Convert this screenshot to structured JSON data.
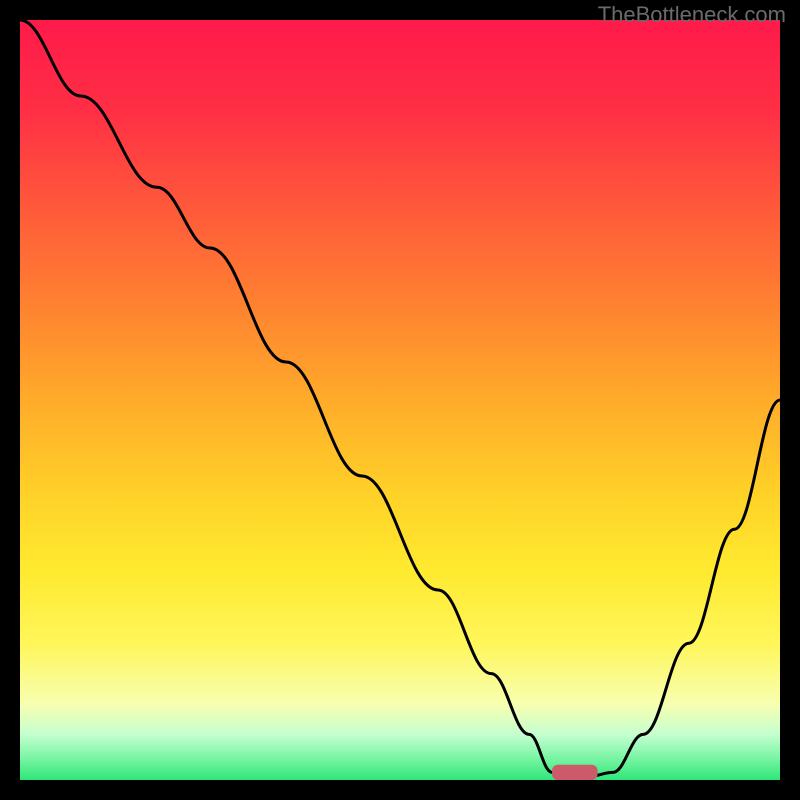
{
  "watermark": "TheBottleneck.com",
  "chart_data": {
    "type": "line",
    "title": "",
    "xlabel": "",
    "ylabel": "",
    "xlim": [
      0,
      100
    ],
    "ylim": [
      0,
      100
    ],
    "background_gradient": {
      "stops": [
        {
          "offset": 0.0,
          "color": "#ff1a4a"
        },
        {
          "offset": 0.12,
          "color": "#ff2f45"
        },
        {
          "offset": 0.25,
          "color": "#ff5a3a"
        },
        {
          "offset": 0.38,
          "color": "#ff8330"
        },
        {
          "offset": 0.5,
          "color": "#ffab2a"
        },
        {
          "offset": 0.62,
          "color": "#ffd028"
        },
        {
          "offset": 0.72,
          "color": "#ffe92e"
        },
        {
          "offset": 0.82,
          "color": "#fff65a"
        },
        {
          "offset": 0.9,
          "color": "#f7ffb0"
        },
        {
          "offset": 0.94,
          "color": "#c5ffd0"
        },
        {
          "offset": 0.97,
          "color": "#7cf5a5"
        },
        {
          "offset": 1.0,
          "color": "#2ee67a"
        }
      ]
    },
    "series": [
      {
        "name": "bottleneck-curve",
        "color": "#000000",
        "stroke_width": 3,
        "x": [
          0,
          8,
          18,
          25,
          35,
          45,
          55,
          62,
          67,
          70,
          75,
          78,
          82,
          88,
          94,
          100
        ],
        "values": [
          100,
          90,
          78,
          70,
          55,
          40,
          25,
          14,
          6,
          1,
          0.5,
          1,
          6,
          18,
          33,
          50
        ]
      }
    ],
    "marker": {
      "name": "optimal-point",
      "x": 73,
      "y": 1,
      "color": "#cc5a6b",
      "width": 6,
      "height": 2
    }
  }
}
